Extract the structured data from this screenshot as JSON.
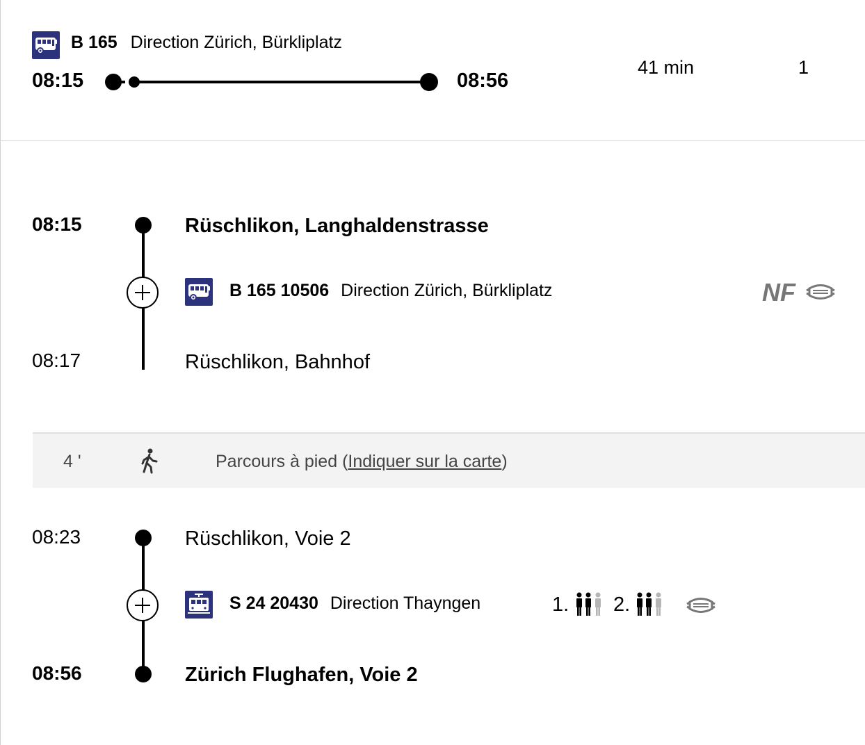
{
  "summary": {
    "line": "B 165",
    "direction": "Direction Zürich, Bürkliplatz",
    "dep_time": "08:15",
    "arr_time": "08:56",
    "duration": "41 min",
    "changes": "1"
  },
  "leg1": {
    "dep_time": "08:15",
    "dep_stop": "Rüschlikon, Langhaldenstrasse",
    "line": "B 165 10506",
    "direction": "Direction Zürich, Bürkliplatz",
    "attribute": "NF",
    "arr_time": "08:17",
    "arr_stop": "Rüschlikon, Bahnhof"
  },
  "walk": {
    "duration": "4 '",
    "text": "Parcours à pied",
    "link_open": "(",
    "link": "Indiquer sur la carte",
    "link_close": ")"
  },
  "leg2": {
    "dep_time": "08:23",
    "dep_stop": "Rüschlikon, Voie 2",
    "line": "S 24 20430",
    "direction": "Direction Thayngen",
    "class1": "1.",
    "class2": "2.",
    "arr_time": "08:56",
    "arr_stop": "Zürich Flughafen, Voie 2"
  },
  "icons": {
    "bus": "bus-icon",
    "train": "train-icon",
    "walk": "pedestrian-icon",
    "mask": "mask-icon",
    "occupancy": "occupancy-icon",
    "expand": "plus-icon"
  },
  "colors": {
    "brand": "#2d327d",
    "walk_bg": "#f3f3f3"
  }
}
